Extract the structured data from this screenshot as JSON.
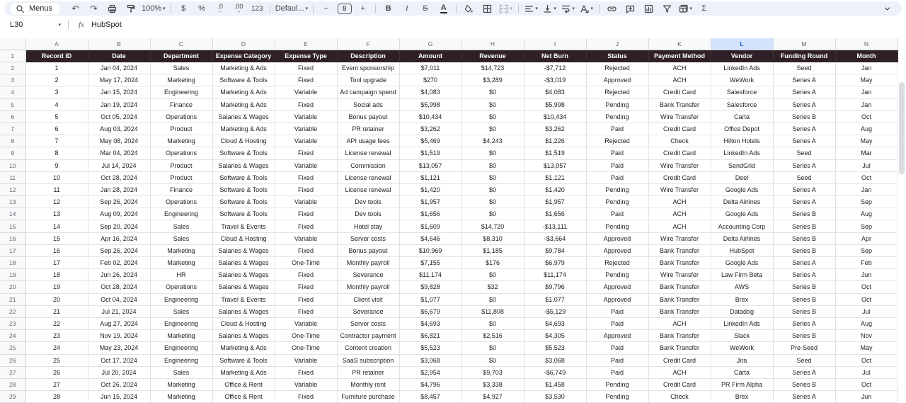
{
  "toolbar": {
    "menus_label": "Menus",
    "zoom_value": "100%",
    "format_currency": "$",
    "format_percent": "%",
    "decrease_decimal": ".0",
    "increase_decimal": ".00",
    "number_format": "123",
    "font_name": "Defaul...",
    "decrease_font": "−",
    "font_size": "8",
    "increase_font": "+",
    "bold": "B",
    "italic": "I",
    "strikethrough": "S",
    "text_color": "A",
    "functions": "Σ"
  },
  "formula_bar": {
    "name_box": "L30",
    "fx": "fx",
    "value": "HubSpot"
  },
  "sheet": {
    "selected_column": "L",
    "columns": [
      "A",
      "B",
      "C",
      "D",
      "E",
      "F",
      "G",
      "H",
      "I",
      "J",
      "K",
      "L",
      "M",
      "N"
    ],
    "headers": [
      "Record ID",
      "Date",
      "Department",
      "Expense Category",
      "Expense Type",
      "Description",
      "Amount",
      "Revenue",
      "Net Burn",
      "Status",
      "Payment Method",
      "Vendor",
      "Funding Round",
      "Month"
    ],
    "rows": [
      [
        "1",
        "Jan 04, 2024",
        "Sales",
        "Marketing & Ads",
        "Fixed",
        "Event sponsorship",
        "$7,011",
        "$14,723",
        "-$7,712",
        "Rejected",
        "ACH",
        "LinkedIn Ads",
        "Seed",
        "Jan"
      ],
      [
        "2",
        "May 17, 2024",
        "Marketing",
        "Software & Tools",
        "Fixed",
        "Tool upgrade",
        "$270",
        "$3,289",
        "-$3,019",
        "Approved",
        "ACH",
        "WeWork",
        "Series A",
        "May"
      ],
      [
        "3",
        "Jan 15, 2024",
        "Engineering",
        "Marketing & Ads",
        "Variable",
        "Ad campaign spend",
        "$4,083",
        "$0",
        "$4,083",
        "Rejected",
        "Credit Card",
        "Salesforce",
        "Series A",
        "Jan"
      ],
      [
        "4",
        "Jan 19, 2024",
        "Finance",
        "Marketing & Ads",
        "Fixed",
        "Social ads",
        "$5,998",
        "$0",
        "$5,998",
        "Pending",
        "Bank Transfer",
        "Salesforce",
        "Series A",
        "Jan"
      ],
      [
        "5",
        "Oct 05, 2024",
        "Operations",
        "Salaries & Wages",
        "Variable",
        "Bonus payout",
        "$10,434",
        "$0",
        "$10,434",
        "Pending",
        "Wire Transfer",
        "Carta",
        "Series B",
        "Oct"
      ],
      [
        "6",
        "Aug 03, 2024",
        "Product",
        "Marketing & Ads",
        "Variable",
        "PR retainer",
        "$3,262",
        "$0",
        "$3,262",
        "Paid",
        "Credit Card",
        "Office Depot",
        "Series A",
        "Aug"
      ],
      [
        "7",
        "May 08, 2024",
        "Marketing",
        "Cloud & Hosting",
        "Variable",
        "API usage fees",
        "$5,469",
        "$4,243",
        "$1,226",
        "Rejected",
        "Check",
        "Hilton Hotels",
        "Series A",
        "May"
      ],
      [
        "8",
        "Mar 04, 2024",
        "Operations",
        "Software & Tools",
        "Fixed",
        "License renewal",
        "$1,519",
        "$0",
        "$1,519",
        "Paid",
        "Credit Card",
        "LinkedIn Ads",
        "Seed",
        "Mar"
      ],
      [
        "9",
        "Jul 14, 2024",
        "Product",
        "Salaries & Wages",
        "Variable",
        "Commission",
        "$13,057",
        "$0",
        "$13,057",
        "Paid",
        "Wire Transfer",
        "SendGrid",
        "Series A",
        "Jul"
      ],
      [
        "10",
        "Oct 28, 2024",
        "Product",
        "Software & Tools",
        "Fixed",
        "License renewal",
        "$1,121",
        "$0",
        "$1,121",
        "Paid",
        "Credit Card",
        "Deel",
        "Seed",
        "Oct"
      ],
      [
        "11",
        "Jan 28, 2024",
        "Finance",
        "Software & Tools",
        "Fixed",
        "License renewal",
        "$1,420",
        "$0",
        "$1,420",
        "Pending",
        "Wire Transfer",
        "Google Ads",
        "Series A",
        "Jan"
      ],
      [
        "12",
        "Sep 26, 2024",
        "Operations",
        "Software & Tools",
        "Variable",
        "Dev tools",
        "$1,957",
        "$0",
        "$1,957",
        "Pending",
        "ACH",
        "Delta Airlines",
        "Series A",
        "Sep"
      ],
      [
        "13",
        "Aug 09, 2024",
        "Engineering",
        "Software & Tools",
        "Fixed",
        "Dev tools",
        "$1,656",
        "$0",
        "$1,656",
        "Paid",
        "ACH",
        "Google Ads",
        "Series B",
        "Aug"
      ],
      [
        "14",
        "Sep 20, 2024",
        "Sales",
        "Travel & Events",
        "Fixed",
        "Hotel stay",
        "$1,609",
        "$14,720",
        "-$13,111",
        "Pending",
        "ACH",
        "Accounting Corp",
        "Series B",
        "Sep"
      ],
      [
        "15",
        "Apr 16, 2024",
        "Sales",
        "Cloud & Hosting",
        "Variable",
        "Server costs",
        "$4,646",
        "$8,310",
        "-$3,664",
        "Approved",
        "Wire Transfer",
        "Delta Airlines",
        "Series B",
        "Apr"
      ],
      [
        "16",
        "Sep 26, 2024",
        "Marketing",
        "Salaries & Wages",
        "Fixed",
        "Bonus payout",
        "$10,969",
        "$1,185",
        "$9,784",
        "Approved",
        "Bank Transfer",
        "HubSpot",
        "Series B",
        "Sep"
      ],
      [
        "17",
        "Feb 02, 2024",
        "Marketing",
        "Salaries & Wages",
        "One-Time",
        "Monthly payroll",
        "$7,155",
        "$176",
        "$6,979",
        "Rejected",
        "Bank Transfer",
        "Google Ads",
        "Series A",
        "Feb"
      ],
      [
        "18",
        "Jun 26, 2024",
        "HR",
        "Salaries & Wages",
        "Fixed",
        "Severance",
        "$11,174",
        "$0",
        "$11,174",
        "Pending",
        "Wire Transfer",
        "Law Firm Beta",
        "Series A",
        "Jun"
      ],
      [
        "19",
        "Oct 28, 2024",
        "Operations",
        "Salaries & Wages",
        "Fixed",
        "Monthly payroll",
        "$9,828",
        "$32",
        "$9,796",
        "Approved",
        "Bank Transfer",
        "AWS",
        "Series B",
        "Oct"
      ],
      [
        "20",
        "Oct 04, 2024",
        "Engineering",
        "Travel & Events",
        "Fixed",
        "Client visit",
        "$1,077",
        "$0",
        "$1,077",
        "Approved",
        "Bank Transfer",
        "Brex",
        "Series B",
        "Oct"
      ],
      [
        "21",
        "Jul 21, 2024",
        "Sales",
        "Salaries & Wages",
        "Fixed",
        "Severance",
        "$6,679",
        "$11,808",
        "-$5,129",
        "Paid",
        "Bank Transfer",
        "Datadog",
        "Series B",
        "Jul"
      ],
      [
        "22",
        "Aug 27, 2024",
        "Engineering",
        "Cloud & Hosting",
        "Variable",
        "Server costs",
        "$4,693",
        "$0",
        "$4,693",
        "Paid",
        "ACH",
        "LinkedIn Ads",
        "Series A",
        "Aug"
      ],
      [
        "23",
        "Nov 19, 2024",
        "Marketing",
        "Salaries & Wages",
        "One-Time",
        "Contractor payment",
        "$6,821",
        "$2,516",
        "$4,305",
        "Approved",
        "Bank Transfer",
        "Slack",
        "Series B",
        "Nov"
      ],
      [
        "24",
        "May 23, 2024",
        "Engineering",
        "Marketing & Ads",
        "One-Time",
        "Content creation",
        "$5,523",
        "$0",
        "$5,523",
        "Paid",
        "Bank Transfer",
        "WeWork",
        "Pre-Seed",
        "May"
      ],
      [
        "25",
        "Oct 17, 2024",
        "Engineering",
        "Software & Tools",
        "Variable",
        "SaaS subscription",
        "$3,068",
        "$0",
        "$3,068",
        "Paid",
        "Credit Card",
        "Jira",
        "Seed",
        "Oct"
      ],
      [
        "26",
        "Jul 20, 2024",
        "Sales",
        "Marketing & Ads",
        "Fixed",
        "PR retainer",
        "$2,954",
        "$9,703",
        "-$6,749",
        "Paid",
        "ACH",
        "Carta",
        "Series A",
        "Jul"
      ],
      [
        "27",
        "Oct 26, 2024",
        "Marketing",
        "Office & Rent",
        "Variable",
        "Monthly rent",
        "$4,796",
        "$3,338",
        "$1,458",
        "Pending",
        "Credit Card",
        "PR Firm Alpha",
        "Series B",
        "Oct"
      ],
      [
        "28",
        "Jun 15, 2024",
        "Marketing",
        "Office & Rent",
        "Fixed",
        "Furniture purchase",
        "$8,457",
        "$4,927",
        "$3,530",
        "Pending",
        "Check",
        "Brex",
        "Series A",
        "Jun"
      ]
    ]
  },
  "colors": {
    "toolbar_bg": "#edf2fa",
    "table_header_bg": "#2e2027",
    "selected_column_bg": "#d3e3fd",
    "selected_column_text": "#0b57d0",
    "gridline": "#e2e2e2"
  }
}
